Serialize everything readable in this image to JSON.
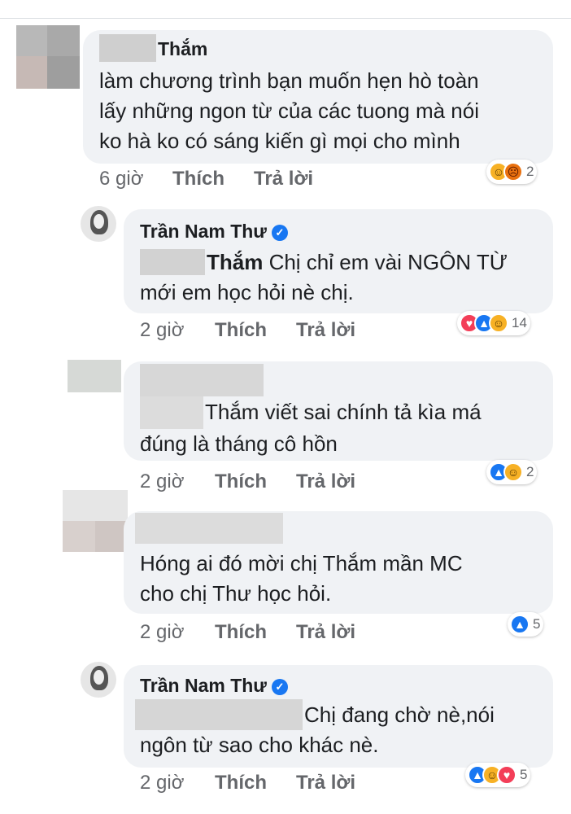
{
  "comments": [
    {
      "name": "Thắm",
      "lines": [
        "làm chương trình bạn muốn hẹn hò toàn",
        "lấy những ngon từ của các tuong mà nói",
        "ko hà ko có sáng kiến gì mọi cho mình"
      ],
      "time": "6 giờ",
      "like": "Thích",
      "reply": "Trả lời",
      "reaction_count": "2"
    },
    {
      "name": "Trần Nam Thư",
      "mention": "Thắm",
      "line1_rest": " Chị chỉ em vài NGÔN TỪ",
      "line2": "mới em học hỏi nè chị.",
      "time": "2 giờ",
      "like": "Thích",
      "reply": "Trả lời",
      "reaction_count": "14"
    },
    {
      "lines": [
        "Thắm viết sai chính tả kìa má",
        "đúng là tháng cô hồn"
      ],
      "time": "2 giờ",
      "like": "Thích",
      "reply": "Trả lời",
      "reaction_count": "2"
    },
    {
      "lines": [
        "Hóng ai đó mời chị Thắm mần MC",
        "cho chị Thư học hỏi."
      ],
      "time": "2 giờ",
      "like": "Thích",
      "reply": "Trả lời",
      "reaction_count": "5"
    },
    {
      "name": "Trần Nam Thư",
      "lines": [
        "Chị đang chờ nè,nói",
        "ngôn từ sao cho khác nè."
      ],
      "time": "2 giờ",
      "like": "Thích",
      "reply": "Trả lời",
      "reaction_count": "5"
    }
  ],
  "colors": {
    "like": "#1877f2",
    "love": "#f33e58",
    "haha": "#f7b125",
    "angry": "#e9710f",
    "bubble": "#f0f2f5"
  },
  "icons": [
    "like-icon",
    "love-icon",
    "haha-icon",
    "angry-icon",
    "verified-icon"
  ]
}
